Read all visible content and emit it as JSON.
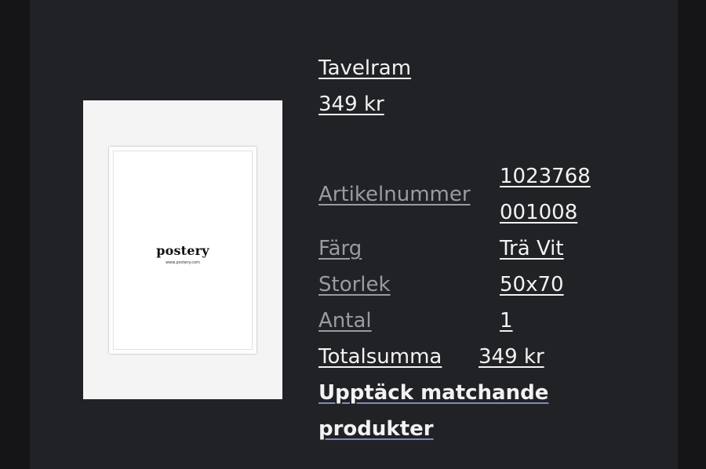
{
  "product": {
    "name": "Tavelram",
    "price": "349 kr",
    "image": {
      "brand": "postery",
      "url_text": "www.postery.com"
    }
  },
  "details": {
    "article_label": "Artikelnummer",
    "article_value_line1": "1023768",
    "article_value_line2": "001008",
    "color_label": "Färg",
    "color_value": "Trä Vit",
    "size_label": "Storlek",
    "size_value": "50x70",
    "quantity_label": "Antal",
    "quantity_value": "1"
  },
  "total": {
    "label": "Totalsumma",
    "value": "349 kr"
  },
  "cta": {
    "line1": "Upptäck matchande",
    "line2": "produkter"
  }
}
